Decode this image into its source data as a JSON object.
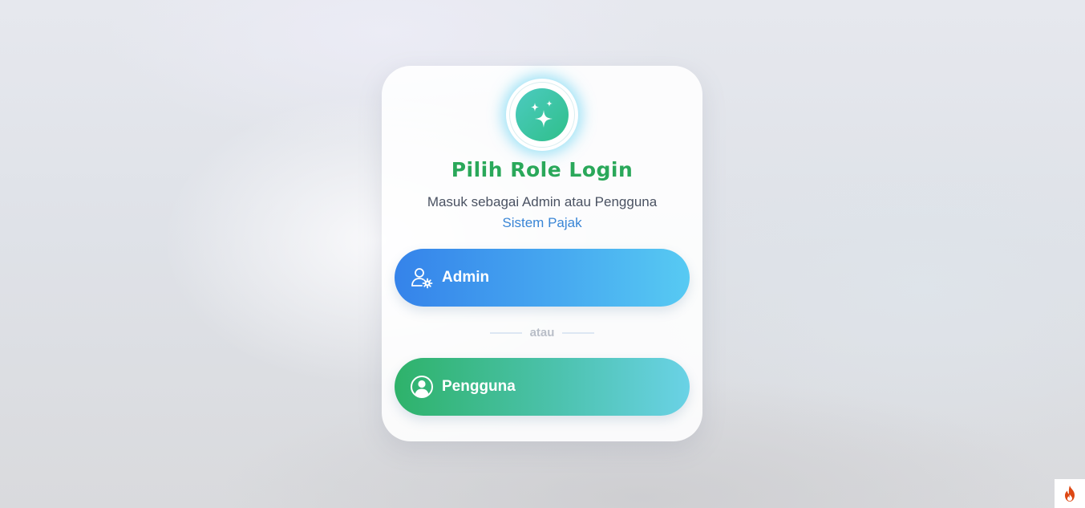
{
  "page": {
    "title": "Pilih Role Login",
    "subtitle": "Masuk sebagai Admin atau Pengguna",
    "brand": "Sistem Pajak"
  },
  "logo": {
    "icon": "sparkles-icon"
  },
  "roles": {
    "admin": {
      "label": "Admin",
      "icon": "user-cog-icon"
    },
    "user": {
      "label": "Pengguna",
      "icon": "user-circle-icon"
    }
  },
  "divider": {
    "text": "atau"
  },
  "corner": {
    "icon": "flame-icon"
  },
  "colors": {
    "title": "#2aa85a",
    "brand": "#3a86d6",
    "admin_gradient": [
      "#3583ea",
      "#57caf3"
    ],
    "user_gradient": [
      "#2eb26a",
      "#6ad2e6"
    ],
    "logo_gradient": [
      "#4ccbc0",
      "#2fbf8a"
    ]
  }
}
